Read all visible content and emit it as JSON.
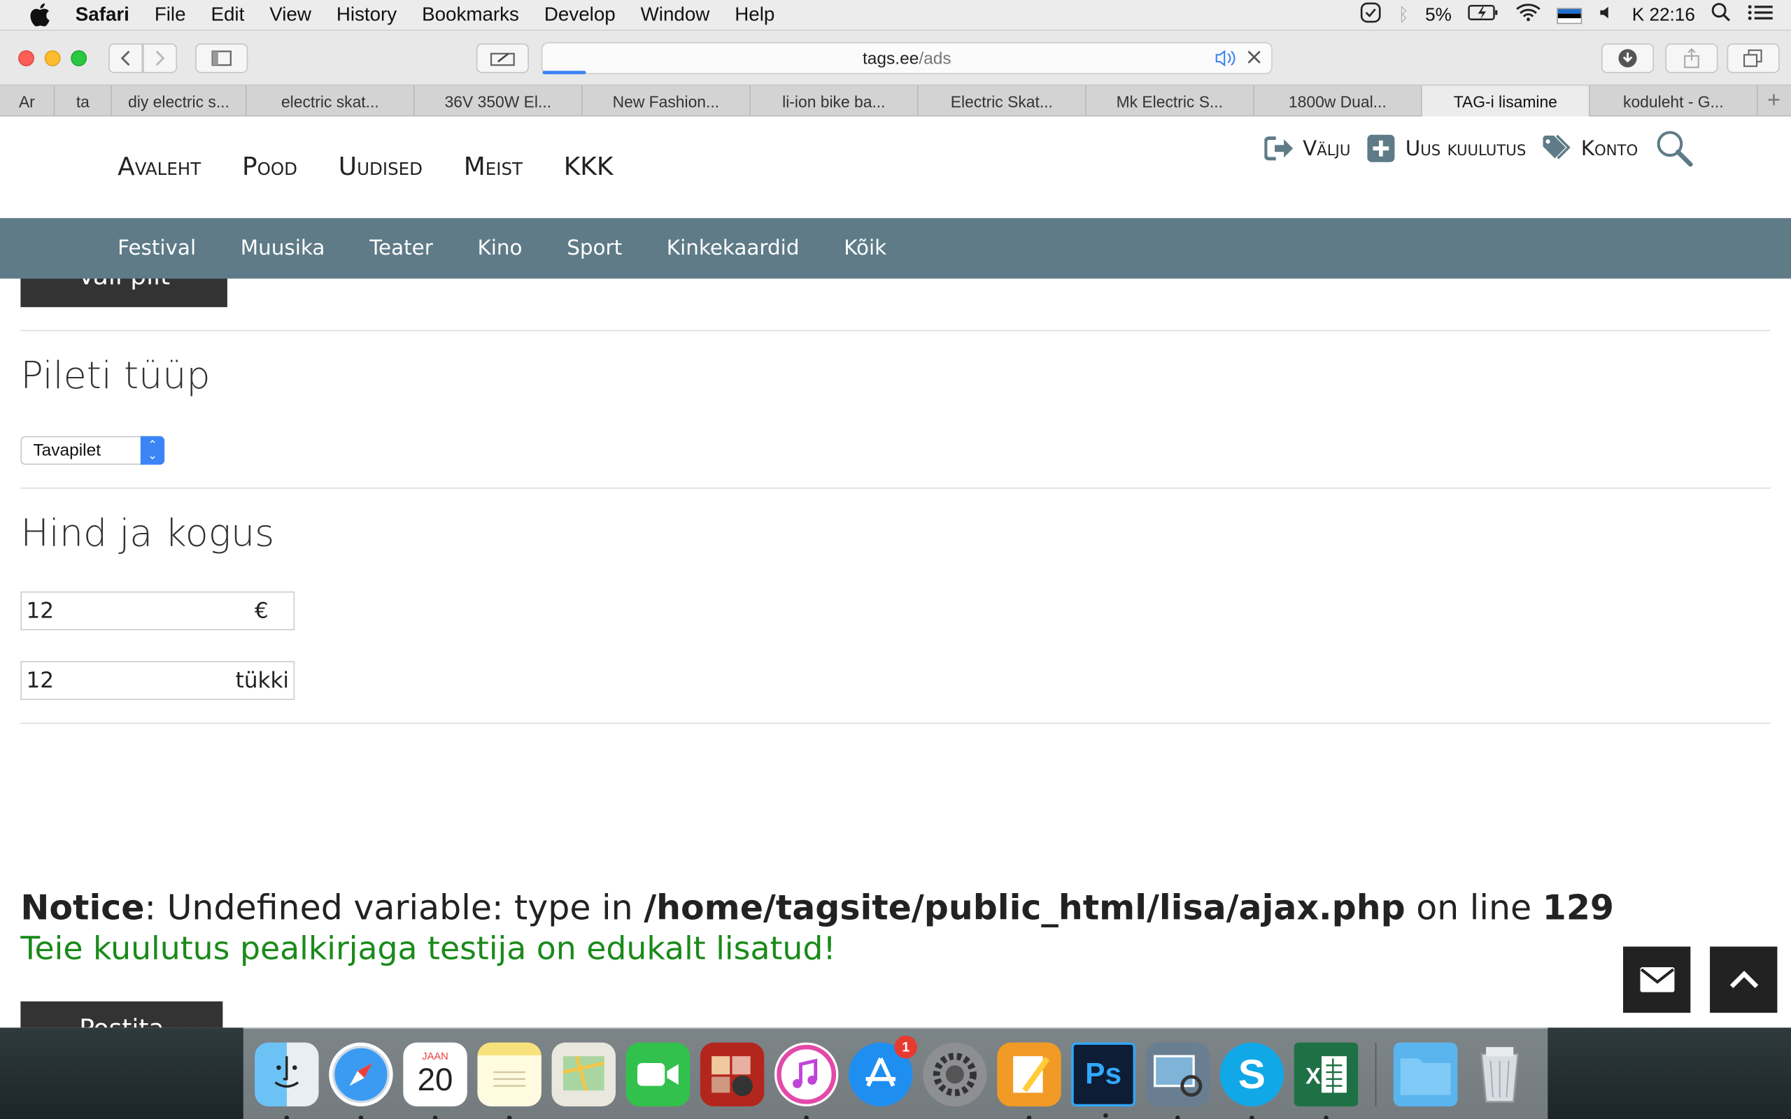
{
  "menubar": {
    "app": "Safari",
    "items": [
      "File",
      "Edit",
      "View",
      "History",
      "Bookmarks",
      "Develop",
      "Window",
      "Help"
    ],
    "battery": "5%",
    "clock": "K 22:16"
  },
  "toolbar": {
    "url_host": "tags.ee",
    "url_path": "/ads"
  },
  "tabs": [
    "Ar",
    "ta",
    "diy electric s...",
    "electric skat...",
    "36V 350W El...",
    "New Fashion...",
    "li-ion bike ba...",
    "Electric Skat...",
    "Mk Electric S...",
    "1800w Dual...",
    "TAG-i lisamine",
    "koduleht - G..."
  ],
  "active_tab_index": 10,
  "site": {
    "main_nav": [
      "Avaleht",
      "Pood",
      "Uudised",
      "Meist",
      "KKK"
    ],
    "util_nav": {
      "logout": "Välju",
      "new_ad": "Uus kuulutus",
      "account": "Konto"
    },
    "categories": [
      "Festival",
      "Muusika",
      "Teater",
      "Kino",
      "Sport",
      "Kinkekaardid",
      "Kõik"
    ]
  },
  "form": {
    "choose_image_button": "Vali pilt",
    "ticket_type_title": "Pileti tüüp",
    "ticket_type_value": "Tavapilet",
    "price_qty_title": "Hind ja kogus",
    "price_value": "12",
    "price_unit": "€",
    "qty_value": "12",
    "qty_unit": "tükki",
    "submit_button": "Postita"
  },
  "messages": {
    "notice_label": "Notice",
    "notice_text": ": Undefined variable: type in ",
    "notice_path": "/home/tagsite/public_html/lisa/ajax.php",
    "notice_line_text": " on line ",
    "notice_line": "129",
    "success": "Teie kuulutus pealkirjaga testija on edukalt lisatud!"
  },
  "dock": {
    "calendar_month": "JAAN",
    "calendar_day": "20",
    "appstore_badge": "1"
  }
}
